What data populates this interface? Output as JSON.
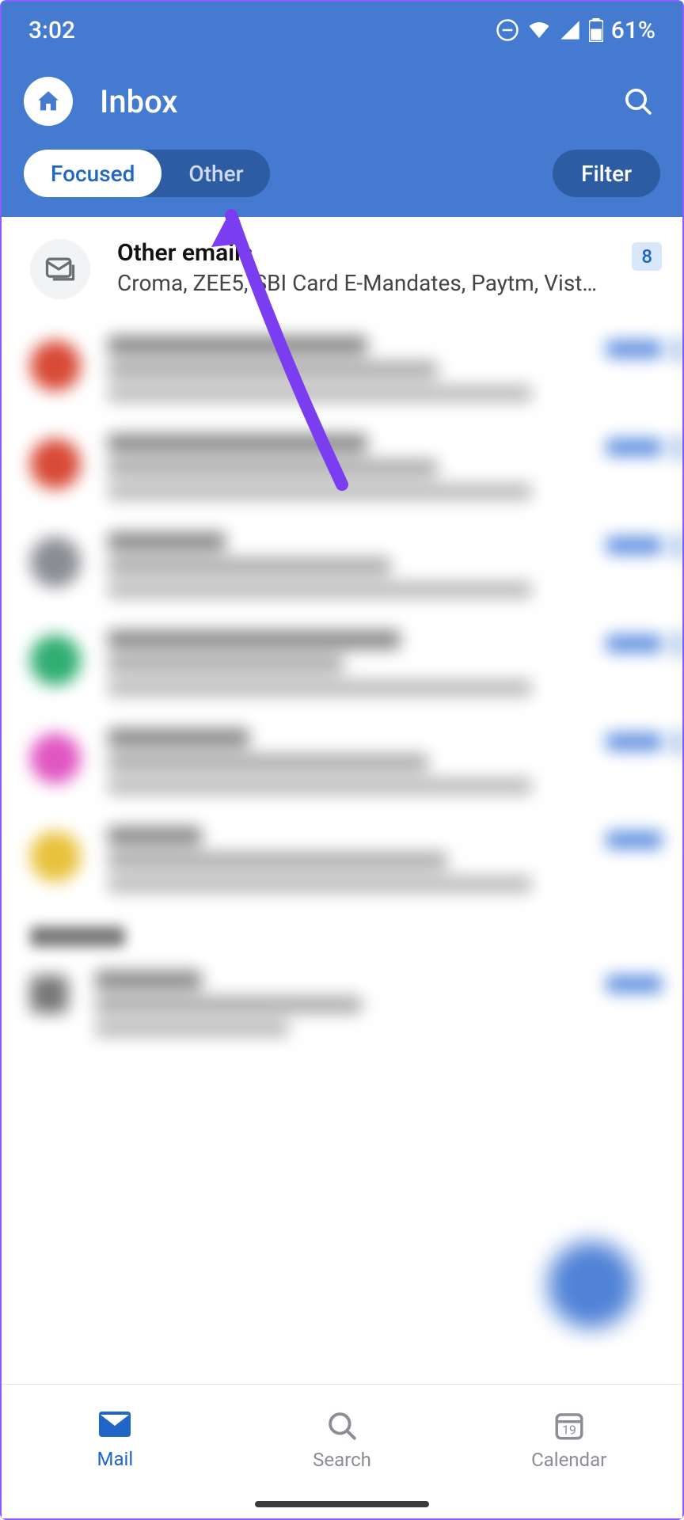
{
  "status": {
    "time": "3:02",
    "battery": "61%"
  },
  "header": {
    "title": "Inbox"
  },
  "tabs": {
    "focused": "Focused",
    "other": "Other",
    "filter": "Filter"
  },
  "other_emails": {
    "title": "Other emails",
    "senders": "Croma, ZEE5, SBI Card E-Mandates, Paytm, Vist…",
    "count": "8"
  },
  "blurred_items": [
    {
      "color": "#d84a36"
    },
    {
      "color": "#d84a36"
    },
    {
      "color": "#8a8d93"
    },
    {
      "color": "#2fae72"
    },
    {
      "color": "#e056c2"
    },
    {
      "color": "#e8c23c"
    }
  ],
  "nav": {
    "mail": "Mail",
    "search": "Search",
    "calendar": "Calendar",
    "cal_day": "19"
  }
}
